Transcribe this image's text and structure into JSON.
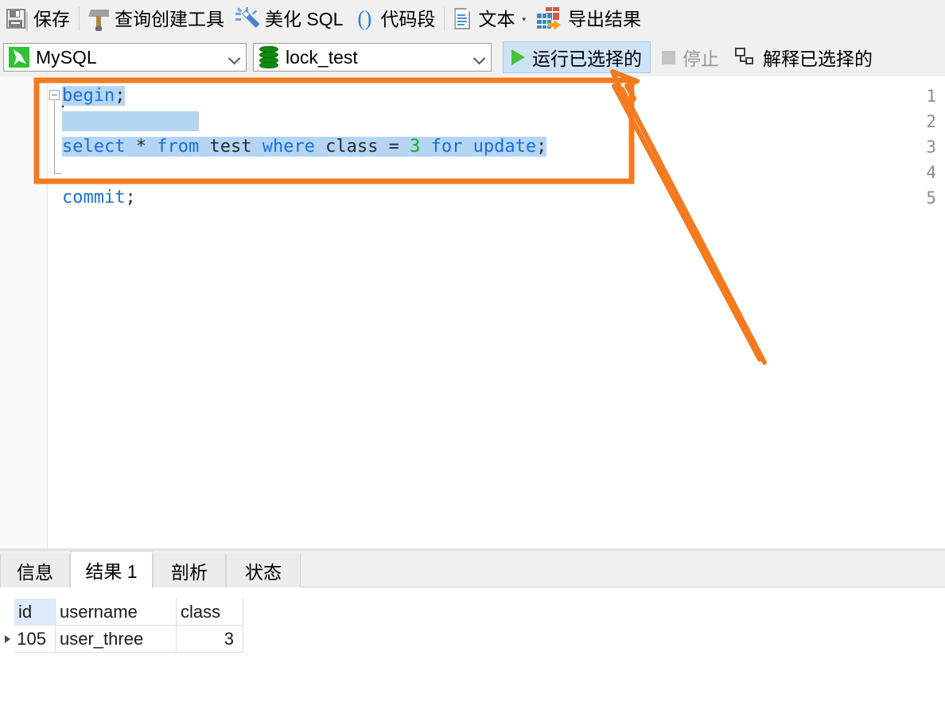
{
  "toolbar_primary": {
    "items": [
      {
        "icon": "save-icon",
        "label": "保存"
      },
      {
        "icon": "hammer-icon",
        "label": "查询创建工具"
      },
      {
        "icon": "magic-wand-icon",
        "label": "美化 SQL"
      },
      {
        "icon": "parentheses-icon",
        "label": "代码段"
      },
      {
        "icon": "document-icon",
        "label": "文本"
      },
      {
        "icon": "export-table-icon",
        "label": "导出结果"
      }
    ]
  },
  "toolbar_secondary": {
    "connection": {
      "icon": "mysql-dolphin-icon",
      "value": "MySQL"
    },
    "database": {
      "icon": "database-icon",
      "value": "lock_test"
    },
    "run_selected": {
      "icon": "play-icon",
      "label": "运行已选择的",
      "active": true
    },
    "stop": {
      "icon": "stop-icon",
      "label": "停止",
      "disabled": true
    },
    "explain_selected": {
      "icon": "explain-icon",
      "label": "解释已选择的"
    }
  },
  "editor": {
    "lines": [
      {
        "number": "1",
        "text": "begin;",
        "selected": true
      },
      {
        "number": "2",
        "text": "",
        "selected": true
      },
      {
        "number": "3",
        "text": "select * from test where class = 3 for update;",
        "selected": true
      },
      {
        "number": "4",
        "text": "",
        "selected": false
      },
      {
        "number": "5",
        "text": "commit;",
        "selected": false
      }
    ],
    "tokens_line1": {
      "keyword": "begin",
      "punct": ";"
    },
    "tokens_line3": {
      "k1": "select",
      "p1": " * ",
      "k2": "from",
      "t1": " test ",
      "k3": "where",
      "t2": " class = ",
      "n1": "3",
      "t3": " ",
      "k4": "for",
      "t4": " ",
      "k5": "update",
      "p2": ";"
    },
    "tokens_line5": {
      "keyword": "commit",
      "punct": ";"
    }
  },
  "annotation": {
    "color": "#f47a20",
    "type": "highlight-box-with-arrow",
    "target": "run-selected-button"
  },
  "bottom_panel": {
    "tabs": [
      {
        "label": "信息",
        "active": false
      },
      {
        "label": "结果 1",
        "active": true
      },
      {
        "label": "剖析",
        "active": false
      },
      {
        "label": "状态",
        "active": false
      }
    ]
  },
  "result_grid": {
    "columns": [
      "id",
      "username",
      "class"
    ],
    "rows": [
      {
        "marker": "▸",
        "id": "105",
        "username": "user_three",
        "class": "3"
      }
    ]
  },
  "colors": {
    "accent_annotation": "#f47a20",
    "keyword": "#1a6fd4",
    "number": "#22a522",
    "selection": "#b5d5f5",
    "toolbar_bg": "#f0f0f0"
  }
}
